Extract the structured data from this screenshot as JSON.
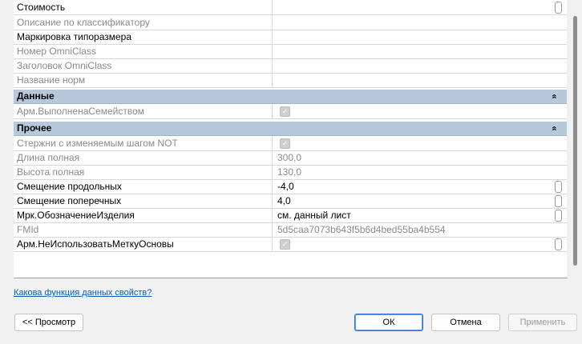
{
  "properties_top": [
    {
      "name": "Стоимость",
      "value": "",
      "gray": false,
      "button": true
    },
    {
      "name": "Описание по классификатору",
      "value": "",
      "gray": true,
      "button": false
    },
    {
      "name": "Маркировка типоразмера",
      "value": "",
      "gray": false,
      "button": false
    },
    {
      "name": "Номер OmniClass",
      "value": "",
      "gray": true,
      "button": false
    },
    {
      "name": "Заголовок OmniClass",
      "value": "",
      "gray": true,
      "button": false
    },
    {
      "name": "Название норм",
      "value": "",
      "gray": true,
      "button": false
    }
  ],
  "group_data": {
    "title": "Данные",
    "icon": "collapse-up-icon"
  },
  "properties_data": [
    {
      "name": "Арм.ВыполненаСемейством",
      "checkbox": true,
      "checked": true,
      "gray": true
    }
  ],
  "group_other": {
    "title": "Прочее",
    "icon": "collapse-up-icon"
  },
  "properties_other": [
    {
      "name": "Стержни с изменяемым шагом NOT",
      "checkbox": true,
      "checked": true,
      "gray": true,
      "button": false
    },
    {
      "name": "Длина полная",
      "value": "300,0",
      "gray": true,
      "button": false
    },
    {
      "name": "Высота полная",
      "value": "130,0",
      "gray": true,
      "button": false
    },
    {
      "name": "Смещение продольных",
      "value": "-4,0",
      "gray": false,
      "button": true
    },
    {
      "name": "Смещение поперечных",
      "value": "4,0",
      "gray": false,
      "button": true
    },
    {
      "name": "Мрк.ОбозначениеИзделия",
      "value": "см. данный лист",
      "gray": false,
      "button": true
    },
    {
      "name": "FMId",
      "value": "5d5caa7073b643f5b6d4bed55ba4b554",
      "gray": true,
      "button": false
    },
    {
      "name": "Арм.НеИспользоватьМеткуОсновы",
      "checkbox": true,
      "checked": true,
      "gray": false,
      "button": true
    }
  ],
  "help_link": "Какова функция данных свойств?",
  "buttons": {
    "preview": "<< Просмотр",
    "ok": "ОК",
    "cancel": "Отмена",
    "apply": "Применить"
  },
  "group_icon_glyph": "»"
}
